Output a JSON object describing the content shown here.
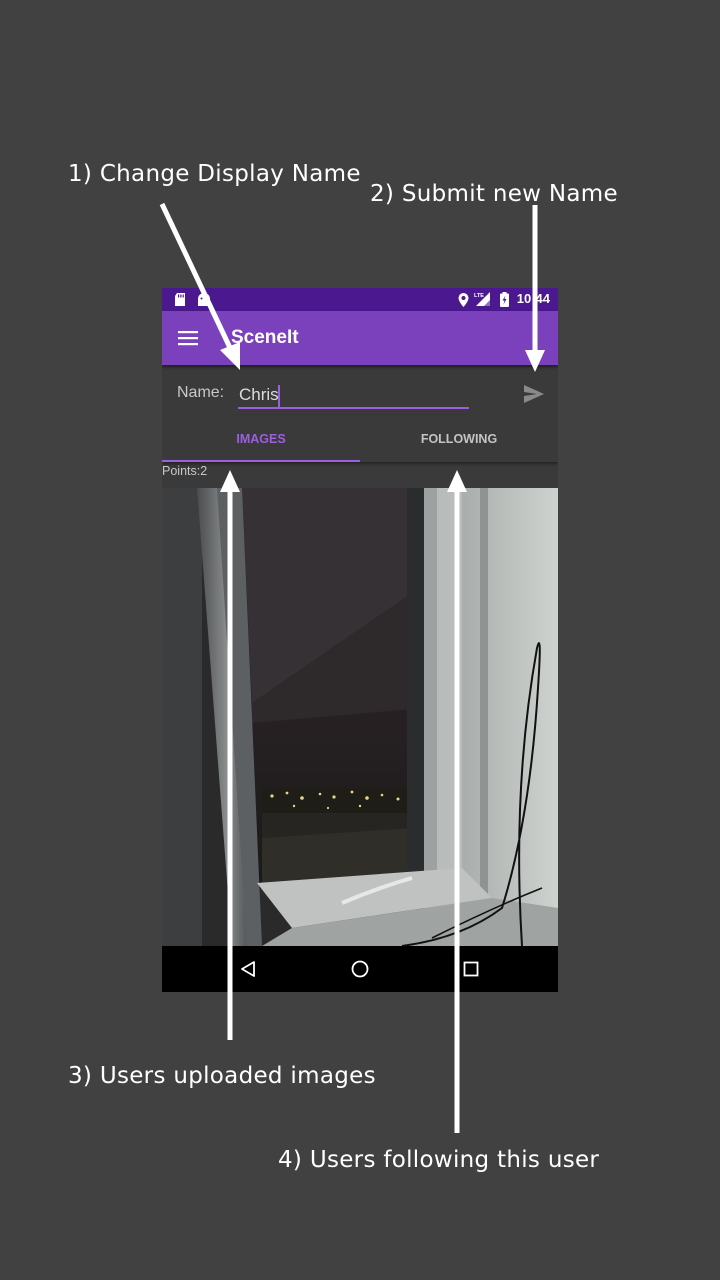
{
  "annotations": {
    "step1": "1) Change Display Name",
    "step2": "2) Submit new Name",
    "step3": "3) Users uploaded images",
    "step4": "4) Users following this user"
  },
  "status_bar": {
    "time": "10:44",
    "network": "LTE",
    "icons": [
      "sd-card-icon",
      "android-icon",
      "location-icon",
      "signal-icon",
      "battery-charging-icon"
    ]
  },
  "app_bar": {
    "title": "SceneIt",
    "menu_icon": "hamburger-menu-icon"
  },
  "profile": {
    "name_label": "Name:",
    "name_value": "Chris",
    "send_icon": "send-icon"
  },
  "tabs": [
    {
      "label": "IMAGES",
      "selected": true
    },
    {
      "label": "FOLLOWING",
      "selected": false
    }
  ],
  "points_text": "Points:2",
  "nav_bar": {
    "icons": [
      "back-icon",
      "home-icon",
      "recents-icon"
    ]
  },
  "colors": {
    "status_bar": "#4b1890",
    "app_bar": "#7b41bd",
    "accent": "#9b5fe0",
    "background": "#414141"
  }
}
